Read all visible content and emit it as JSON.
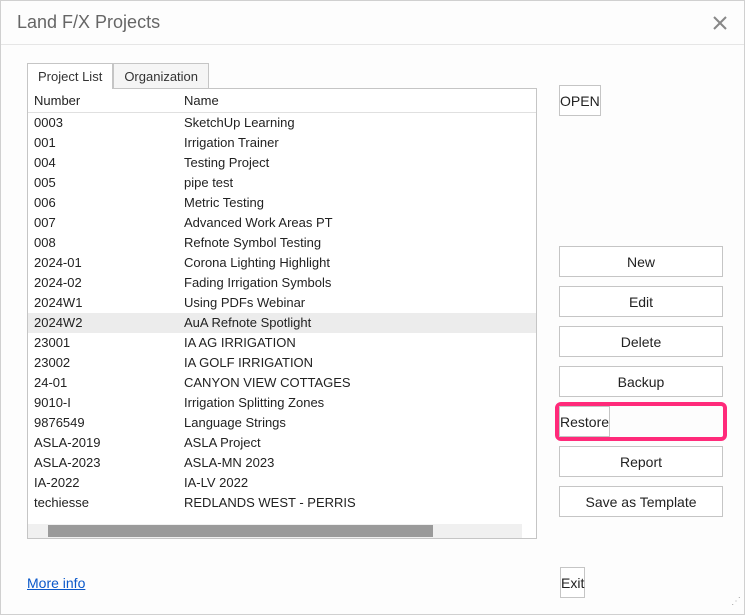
{
  "window": {
    "title": "Land F/X Projects"
  },
  "tabs": {
    "projectList": "Project List",
    "organization": "Organization",
    "active": 0
  },
  "columns": {
    "number": "Number",
    "name": "Name"
  },
  "rows": [
    {
      "number": "0003",
      "name": "SketchUp Learning"
    },
    {
      "number": "001",
      "name": "Irrigation Trainer"
    },
    {
      "number": "004",
      "name": "Testing Project"
    },
    {
      "number": "005",
      "name": "pipe test"
    },
    {
      "number": "006",
      "name": "Metric Testing"
    },
    {
      "number": "007",
      "name": "Advanced Work Areas PT"
    },
    {
      "number": "008",
      "name": "Refnote Symbol Testing"
    },
    {
      "number": "2024-01",
      "name": "Corona Lighting Highlight"
    },
    {
      "number": "2024-02",
      "name": "Fading Irrigation Symbols"
    },
    {
      "number": "2024W1",
      "name": "Using PDFs Webinar"
    },
    {
      "number": "2024W2",
      "name": "AuA Refnote Spotlight"
    },
    {
      "number": "23001",
      "name": "IA AG IRRIGATION"
    },
    {
      "number": "23002",
      "name": "IA GOLF IRRIGATION"
    },
    {
      "number": "24-01",
      "name": "CANYON VIEW COTTAGES"
    },
    {
      "number": "9010-I",
      "name": "Irrigation Splitting Zones"
    },
    {
      "number": "9876549",
      "name": "Language Strings"
    },
    {
      "number": "ASLA-2019",
      "name": "ASLA Project"
    },
    {
      "number": "ASLA-2023",
      "name": "ASLA-MN 2023"
    },
    {
      "number": "IA-2022",
      "name": "IA-LV 2022"
    },
    {
      "number": "techiesse",
      "name": "REDLANDS WEST - PERRIS"
    }
  ],
  "selectedIndex": 10,
  "buttons": {
    "open": "OPEN",
    "new": "New",
    "edit": "Edit",
    "delete": "Delete",
    "backup": "Backup",
    "restore": "Restore",
    "report": "Report",
    "saveAsTemplate": "Save as Template",
    "exit": "Exit"
  },
  "links": {
    "moreInfo": "More info"
  },
  "highlight": {
    "color": "#ff2a7a",
    "target": "restore"
  }
}
